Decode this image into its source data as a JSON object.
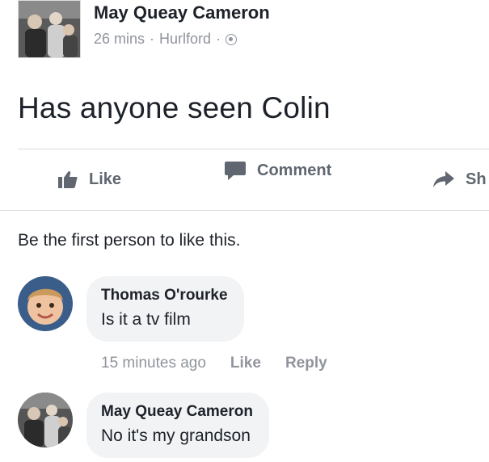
{
  "post": {
    "author": "May Queay Cameron",
    "time": "26 mins",
    "separator": "·",
    "location": "Hurlford",
    "separator2": "·",
    "privacy_icon": "globe-icon",
    "body": "Has anyone seen Colin"
  },
  "actions": {
    "like_label": "Like",
    "comment_label": "Comment",
    "share_label": "Sh",
    "like_icon": "thumbs-up-icon",
    "comment_icon": "speech-bubble-icon",
    "share_icon": "share-arrow-icon"
  },
  "like_summary": "Be the first person to like this.",
  "comments": [
    {
      "author": "Thomas O'rourke",
      "text": "Is it a tv film",
      "time": "15 minutes ago",
      "like_label": "Like",
      "reply_label": "Reply"
    },
    {
      "author": "May Queay Cameron",
      "text": "No it's my grandson"
    }
  ],
  "colors": {
    "text": "#1d2129",
    "secondary": "#90949c",
    "action": "#606770",
    "bubble": "#f2f3f5",
    "divider": "#dadde1"
  }
}
